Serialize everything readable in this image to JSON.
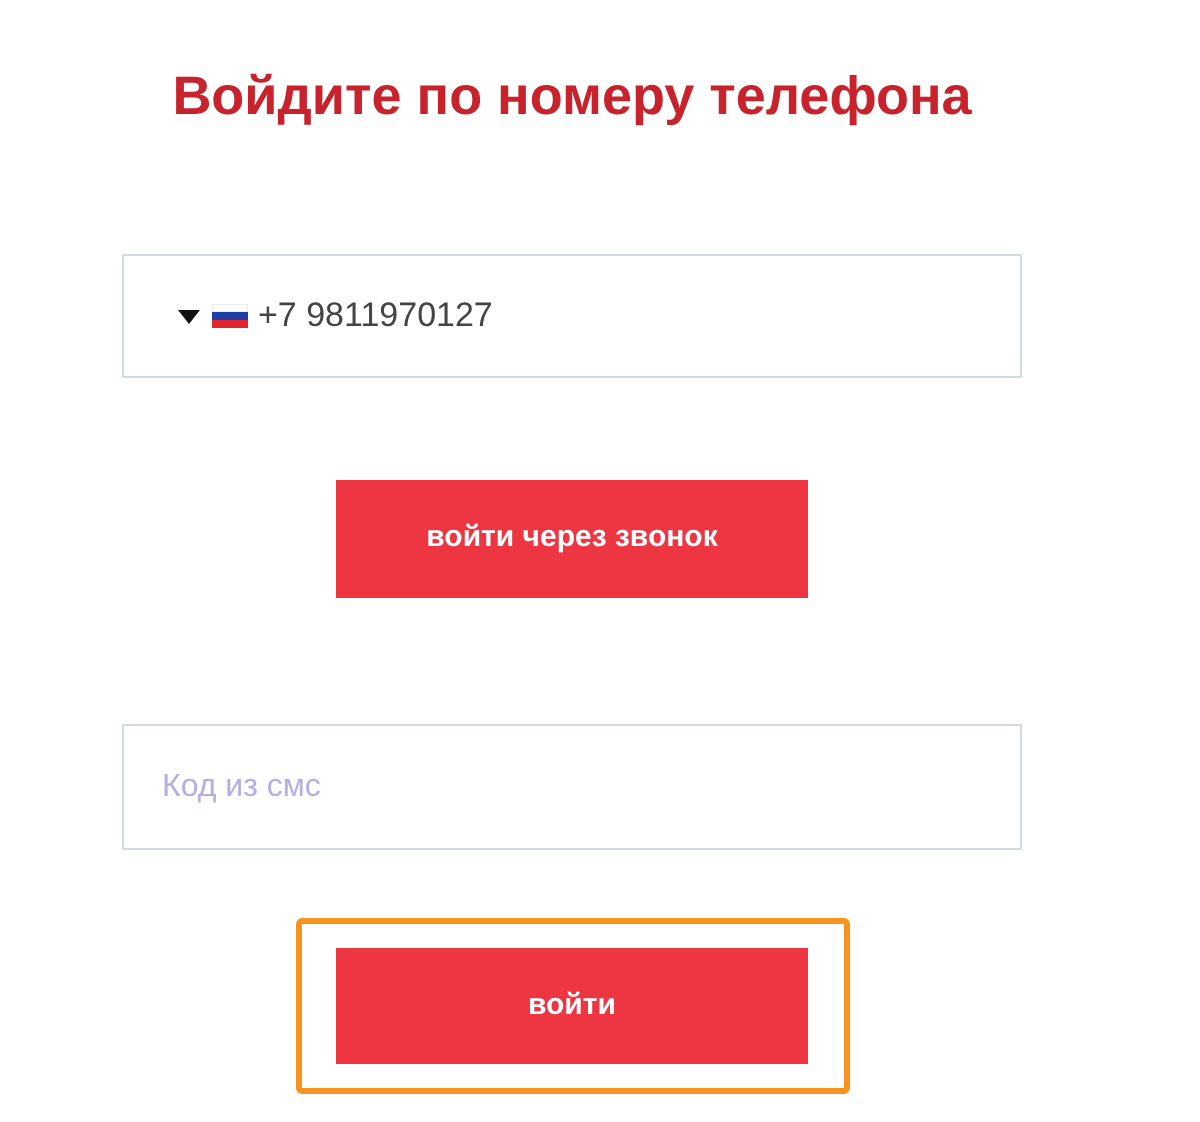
{
  "title": "Войдите по номеру телефона",
  "phone_field": {
    "value": "+7 9811970127"
  },
  "call_button": {
    "label": "войти через звонок"
  },
  "sms_field": {
    "placeholder": "Код из смс"
  },
  "login_button": {
    "label": "войти",
    "highlighted": true
  }
}
